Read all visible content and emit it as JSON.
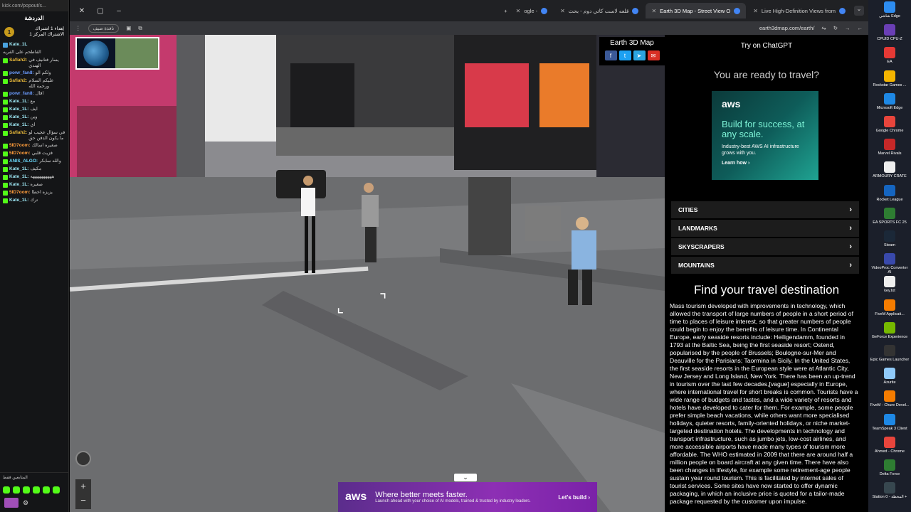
{
  "chat": {
    "url": "kick.com/popout/s...",
    "title": "الدردشة",
    "pinned_text": "إهداء 1 اشتراك\nالاشتراك المركز 1",
    "pinned_user": "Kate_1L",
    "pinned_msg": "الفاطحم على الفريه",
    "messages": [
      {
        "user": "Safiah2:",
        "text": "يسار فتانيف في الهندي",
        "color": "#e8b839"
      },
      {
        "user": "powr_fan8:",
        "text": "ولكم الو",
        "color": "#6b9cff"
      },
      {
        "user": "Safiah2:",
        "text": "عليكم السلام ورحمة الله",
        "color": "#e8b839"
      },
      {
        "user": "powr_fan8:",
        "text": "اقال",
        "color": "#6b9cff"
      },
      {
        "user": "Kate_1L:",
        "text": "مع",
        "color": "#9be3f0"
      },
      {
        "user": "Kate_1L:",
        "text": "ايف",
        "color": "#9be3f0"
      },
      {
        "user": "Kate_1L:",
        "text": "وين",
        "color": "#9be3f0"
      },
      {
        "user": "Kate_1L:",
        "text": "اي",
        "color": "#9be3f0"
      },
      {
        "user": "Safiah2:",
        "text": "في سؤال عجيب لو ما يكون الدفن حق",
        "color": "#e8b839"
      },
      {
        "user": "5lD7oom:",
        "text": "صغيره اسالك",
        "color": "#ff9d3b"
      },
      {
        "user": "5lD7oom:",
        "text": "فزيت قلبي",
        "color": "#ff9d3b"
      },
      {
        "user": "ANIS_ALGO:",
        "text": "والله سابكر",
        "color": "#6bdcff"
      },
      {
        "user": "Kate_1L:",
        "text": "مكيف",
        "color": "#9be3f0"
      },
      {
        "user": "Kate_1L:",
        "text": "ههههههههههه",
        "color": "#9be3f0"
      },
      {
        "user": "Kate_1L:",
        "text": "صغيره",
        "color": "#9be3f0"
      },
      {
        "user": "5lD7oom:",
        "text": "يزيزه اخطا",
        "color": "#ff9d3b"
      },
      {
        "user": "Kate_1L:",
        "text": "ترك",
        "color": "#9be3f0"
      }
    ],
    "footer_label": "المتابعين فقط"
  },
  "browser": {
    "tabs": [
      {
        "label": "ogle -",
        "active": false
      },
      {
        "label": "قلعه لاست كاتي دوم - بحث",
        "active": false
      },
      {
        "label": "Earth 3D Map - Street View O",
        "active": true
      },
      {
        "label": "Live High-Definition Views from",
        "active": false
      }
    ],
    "guest_label": "نافذة ضيف",
    "url": "earth3dmap.com/earth/"
  },
  "streetview": {
    "site_title": "Earth 3D Map",
    "collapse_glyph": "⌄",
    "zoom_in": "+",
    "zoom_out": "−"
  },
  "ad_bottom": {
    "brand": "aws",
    "headline": "Where better meets faster.",
    "sub": "Launch ahead with your choice of AI models, trained & trusted by industry leaders.",
    "cta": "Let's build ›"
  },
  "sidebar": {
    "chatgpt": "Try on ChatGPT",
    "ready": "You are ready to travel?",
    "ad": {
      "brand": "aws",
      "headline": "Build for success, at any scale.",
      "sub": "Industry-best AWS AI infrastructure grows with you.",
      "cta": "Learn how ›"
    },
    "categories": [
      "CITIES",
      "LANDMARKS",
      "SKYSCRAPERS",
      "MOUNTAINS"
    ],
    "find_title": "Find your travel destination",
    "description": "Mass tourism developed with improvements in technology, which allowed the transport of large numbers of people in a short period of time to places of leisure interest, so that greater numbers of people could begin to enjoy the benefits of leisure time. In Continental Europe, early seaside resorts include: Heiligendamm, founded in 1793 at the Baltic Sea, being the first seaside resort; Ostend, popularised by the people of Brussels; Boulogne-sur-Mer and Deauville for the Parisians; Taormina in Sicily. In the United States, the first seaside resorts in the European style were at Atlantic City, New Jersey and Long Island, New York. There has been an up-trend in tourism over the last few decades,[vague] especially in Europe, where international travel for short breaks is common. Tourists have a wide range of budgets and tastes, and a wide variety of resorts and hotels have developed to cater for them. For example, some people prefer simple beach vacations, while others want more specialised holidays, quieter resorts, family-oriented holidays, or niche market-targeted destination hotels. The developments in technology and transport infrastructure, such as jumbo jets, low-cost airlines, and more accessible airports have made many types of tourism more affordable. The WHO estimated in 2009 that there are around half a million people on board aircraft at any given time. There have also been changes in lifestyle, for example some retirement-age people sustain year round tourism. This is facilitated by internet sales of tourist services. Some sites have now started to offer dynamic packaging, in which an inclusive price is quoted for a tailor-made package requested by the customer upon impulse."
  },
  "desktop": [
    {
      "label": "شاشي Edge",
      "color": "#2d8cf0"
    },
    {
      "label": "CPUID CPU-Z",
      "color": "#6a3fb5"
    },
    {
      "label": "EA",
      "color": "#e53935"
    },
    {
      "label": "Rockstar Games ...",
      "color": "#f4b400"
    },
    {
      "label": "Microsoft Edge",
      "color": "#1e88e5"
    },
    {
      "label": "Google Chrome",
      "color": "#e8453c"
    },
    {
      "label": "Marvel Rivals",
      "color": "#c62828"
    },
    {
      "label": "ARMOURY CRATE",
      "color": "#eeeeee"
    },
    {
      "label": "Rocket League",
      "color": "#1565c0"
    },
    {
      "label": "EA SPORTS FC 25",
      "color": "#2e7d32"
    },
    {
      "label": "Steam",
      "color": "#1b2838"
    },
    {
      "label": "VideoProc Converter AI",
      "color": "#3949ab"
    },
    {
      "label": "key.txt",
      "color": "#eeeeee"
    },
    {
      "label": "FiveM Applicati...",
      "color": "#f57c00"
    },
    {
      "label": "GeForce Experience",
      "color": "#76b900"
    },
    {
      "label": "Epic Games Launcher",
      "color": "#333333"
    },
    {
      "label": "Azurite",
      "color": "#90caf9"
    },
    {
      "label": "FiveM - Chure Devel...",
      "color": "#f57c00"
    },
    {
      "label": "TeamSpeak 3 Client",
      "color": "#1e88e5"
    },
    {
      "label": "Ahmed - Chrome",
      "color": "#e8453c"
    },
    {
      "label": "Delta Force",
      "color": "#2e7d32"
    },
    {
      "label": "Station 0 - المحطة +",
      "color": "#37474f"
    }
  ]
}
